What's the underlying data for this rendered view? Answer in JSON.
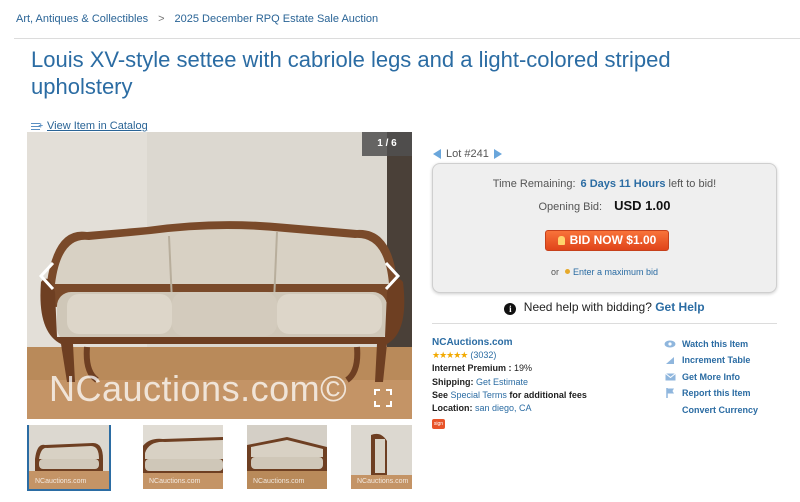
{
  "breadcrumb": {
    "items": [
      "Art, Antiques & Collectibles",
      "2025 December RPQ Estate Sale Auction"
    ],
    "separator": ">"
  },
  "title": "Louis XV-style settee with cabriole legs and a light-colored striped upholstery",
  "catalog_link": "View Item in Catalog",
  "gallery": {
    "counter": "1 / 6",
    "watermark": "NCauctions.com©",
    "thumb_watermark": "NCauctions.com"
  },
  "lot": {
    "label": "Lot #241"
  },
  "bid": {
    "time_label": "Time Remaining:",
    "time_value": "6 Days 11 Hours",
    "time_suffix": "left to bid!",
    "opening_label": "Opening Bid:",
    "opening_value": "USD 1.00",
    "button_label": "BID NOW $1.00",
    "max_prefix": "or",
    "max_link": "Enter a maximum bid"
  },
  "help": {
    "text": "Need help with bidding?",
    "link": "Get Help"
  },
  "seller": {
    "name": "NCAuctions.com",
    "stars": "★★★★★",
    "rating_count": "(3032)",
    "premium_label": "Internet Premium :",
    "premium_value": "19%",
    "shipping_label": "Shipping:",
    "shipping_link": "Get Estimate",
    "terms_prefix": "See",
    "terms_link": "Special Terms",
    "terms_suffix": "for additional fees",
    "location_label": "Location:",
    "location_value": "san diego, CA",
    "badge": "sign"
  },
  "actions": {
    "watch": "Watch this Item",
    "increment": "Increment Table",
    "more_info": "Get More Info",
    "report": "Report this Item",
    "currency": "Convert Currency"
  },
  "colors": {
    "link": "#2b6ca3",
    "bid_button": "#e8542a",
    "stars": "#f2a900"
  }
}
